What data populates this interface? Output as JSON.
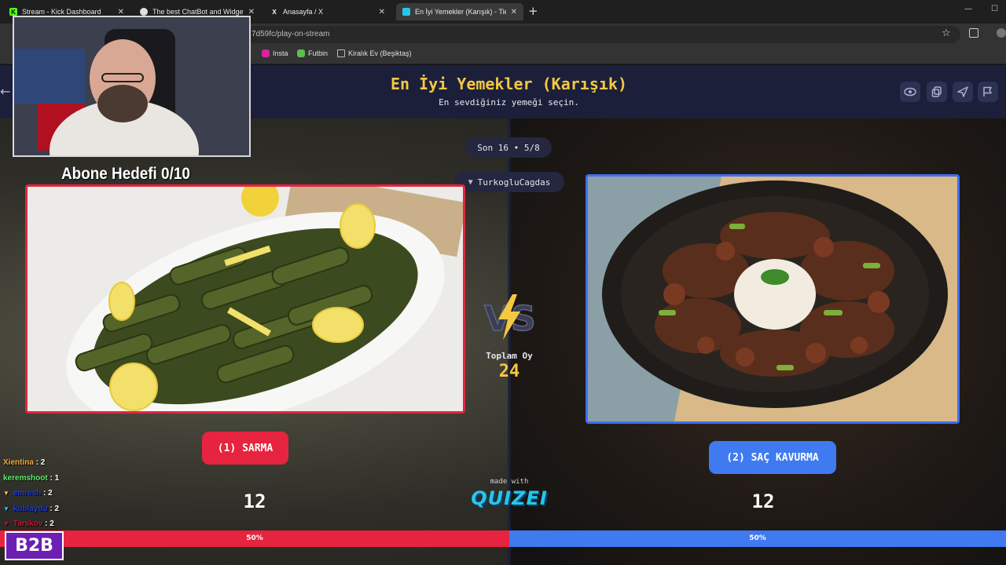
{
  "browser": {
    "tabs": [
      {
        "label": "Stream - Kick Dashboard",
        "favicon": "kick-icon",
        "color": "#53fc18",
        "active": false
      },
      {
        "label": "The best ChatBot and Widgets",
        "favicon": "botrix-icon",
        "color": "#e0e0e0",
        "active": false
      },
      {
        "label": "Anasayfa / X",
        "favicon": "x-icon",
        "color": "#ffffff",
        "active": false
      },
      {
        "label": "En İyi Yemekler (Karışık) - Tier Li",
        "favicon": "quizei-icon",
        "color": "#27c6e8",
        "active": true
      }
    ],
    "url": "7d59fc/play-on-stream",
    "bookmarks": [
      {
        "label": "Insta",
        "color": "#d6249f"
      },
      {
        "label": "Futbin",
        "color": "#5cc04a"
      },
      {
        "label": "Kiralık Ev (Beşiktaş)",
        "color": "#bbbbbb"
      }
    ]
  },
  "quiz": {
    "title": "En İyi Yemekler (Karışık)",
    "subtitle": "En sevdiğiniz yemeği seçin.",
    "round": "Son 16 • 5/8",
    "user": "TurkogluCagdas",
    "total_label": "Toplam Oy",
    "total_votes": "24",
    "made_with": "made with",
    "brand": "QUIZEI",
    "options": [
      {
        "label": "(1) SARMA",
        "votes": "12",
        "percent": "50%",
        "fraction": 0.5,
        "color": "#e6243f"
      },
      {
        "label": "(2) SAÇ KAVURMA",
        "votes": "12",
        "percent": "50%",
        "fraction": 0.5,
        "color": "#3f7af0"
      }
    ]
  },
  "overlay": {
    "sub_goal": "Abone Hedefi 0/10",
    "chat": [
      {
        "name": "Xientina",
        "count": ": 2",
        "color": "#f2a93b",
        "icon": ""
      },
      {
        "name": "keremshoot",
        "count": ": 1",
        "color": "#5cf06a",
        "icon": ""
      },
      {
        "name": "emresh",
        "count": ": 2",
        "color": "#1f3fd8",
        "icon": "▼"
      },
      {
        "name": "kublaydu",
        "count": ": 2",
        "color": "#1f3fd8",
        "icon": "▼"
      },
      {
        "name": "Tarskov",
        "count": ": 2",
        "color": "#c3162e",
        "icon": "▼"
      }
    ],
    "logo": "B2B"
  }
}
